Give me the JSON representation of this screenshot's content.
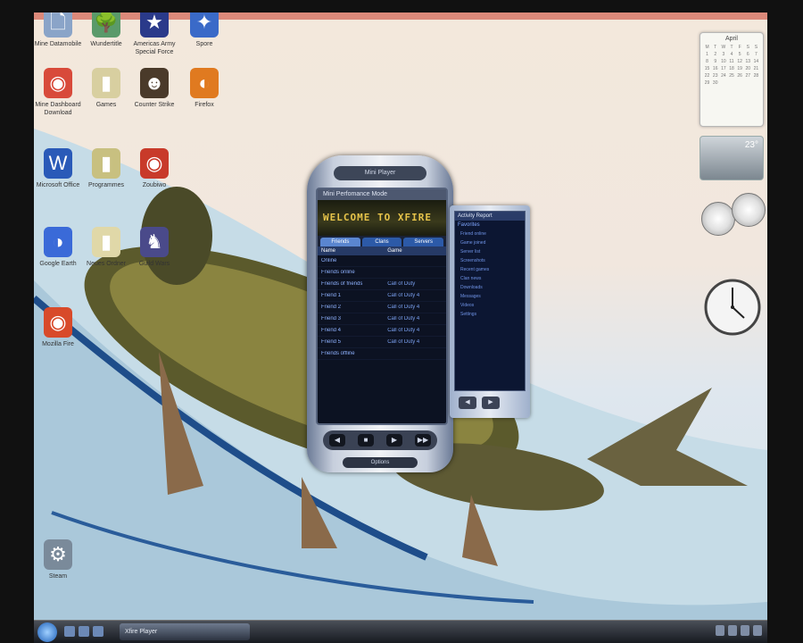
{
  "desktop": {
    "icons": [
      {
        "label": "Mine Datamobile",
        "glyph": "🗋",
        "color": "#8aa4c8"
      },
      {
        "label": "Wundertitle",
        "glyph": "🌳",
        "color": "#5a9a6a"
      },
      {
        "label": "Americas Army Special Force",
        "glyph": "★",
        "color": "#2a3a8a"
      },
      {
        "label": "Spore",
        "glyph": "✦",
        "color": "#3a6ac8"
      },
      {
        "label": "Mine Dashboard Download",
        "glyph": "◉",
        "color": "#d84a3a"
      },
      {
        "label": "Games",
        "glyph": "▮",
        "color": "#d8cfa0"
      },
      {
        "label": "Counter Strike",
        "glyph": "☻",
        "color": "#4a3a2a"
      },
      {
        "label": "Firefox",
        "glyph": "◐",
        "color": "#e07a20"
      },
      {
        "label": "Microsoft Office",
        "glyph": "W",
        "color": "#2a5ab8"
      },
      {
        "label": "Programmes",
        "glyph": "▮",
        "color": "#c8c080"
      },
      {
        "label": "Zoubiwo",
        "glyph": "◉",
        "color": "#c83a2a"
      },
      {
        "label": "Google Earth",
        "glyph": "◑",
        "color": "#3a6ad8"
      },
      {
        "label": "Neues Ordner",
        "glyph": "▮",
        "color": "#e0d8a8"
      },
      {
        "label": "Guild Wars",
        "glyph": "♞",
        "color": "#4a4a8a"
      },
      {
        "label": "Mozilla Fire",
        "glyph": "◉",
        "color": "#d84a2a"
      },
      {
        "label": "Steam",
        "glyph": "⚙",
        "color": "#7a8a9a"
      }
    ]
  },
  "player": {
    "top_label": "Mini Player",
    "title": "Mini Perfomance Mode",
    "banner": "WELCOME TO XFIRE",
    "tabs": [
      "Friends",
      "Clans",
      "Servers"
    ],
    "col_headers": [
      "Name",
      "Game"
    ],
    "rows": [
      {
        "name": "Online",
        "game": ""
      },
      {
        "name": "Friends online",
        "game": ""
      },
      {
        "name": "Friends of friends",
        "game": "Call of Duty"
      },
      {
        "name": "Friend 1",
        "game": "Call of Duty 4"
      },
      {
        "name": "Friend 2",
        "game": "Call of Duty 4"
      },
      {
        "name": "Friend 3",
        "game": "Call of Duty 4"
      },
      {
        "name": "Friend 4",
        "game": "Call of Duty 4"
      },
      {
        "name": "Friend 5",
        "game": "Call of Duty 4"
      },
      {
        "name": "Friends offline",
        "game": ""
      }
    ],
    "controls": [
      "◀",
      "■",
      "▶",
      "▶▶"
    ],
    "footer": "Options"
  },
  "side_panel": {
    "title": "Activity Report",
    "subtitle": "Favorites",
    "items": [
      "Friend online",
      "Game joined",
      "Server list",
      "Screenshots",
      "Recent games",
      "Clan news",
      "Downloads",
      "Messages",
      "Videos",
      "Settings"
    ],
    "buttons": [
      "◀",
      "▶"
    ]
  },
  "gadgets": {
    "calendar_month": "April",
    "calendar_days": [
      "M",
      "T",
      "W",
      "T",
      "F",
      "S",
      "S",
      "1",
      "2",
      "3",
      "4",
      "5",
      "6",
      "7",
      "8",
      "9",
      "10",
      "11",
      "12",
      "13",
      "14",
      "15",
      "16",
      "17",
      "18",
      "19",
      "20",
      "21",
      "22",
      "23",
      "24",
      "25",
      "26",
      "27",
      "28",
      "29",
      "30"
    ],
    "weather_temp": "23°"
  },
  "taskbar": {
    "task_label": "Xfire Player"
  }
}
